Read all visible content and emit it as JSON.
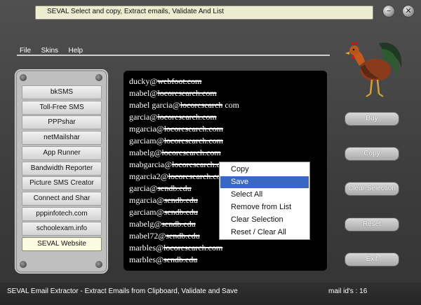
{
  "title": "SEVAL   Select and copy, Extract emails, Validate And List",
  "window_buttons": {
    "minimize": "−",
    "close": "✕"
  },
  "menu": [
    "File",
    "Skins",
    "Help"
  ],
  "sidebar": {
    "items": [
      {
        "label": "bkSMS"
      },
      {
        "label": "Toll-Free SMS"
      },
      {
        "label": "PPPshar"
      },
      {
        "label": "netMailshar"
      },
      {
        "label": "App Runner"
      },
      {
        "label": "Bandwidth Reporter"
      },
      {
        "label": "Picture SMS Creator"
      },
      {
        "label": "Connect and Shar"
      },
      {
        "label": "pppinfotech.com"
      },
      {
        "label": "schoolexam.info"
      },
      {
        "label": "SEVAL Website",
        "active": true
      }
    ]
  },
  "emails": [
    {
      "user": "ducky@",
      "domain": "webfoot.com"
    },
    {
      "user": "mabel@",
      "domain": "locoresearch.com"
    },
    {
      "user": "mabel garcia@",
      "domain": "locoresearch",
      "suffix": " com"
    },
    {
      "user": "garcia@",
      "domain": "locoresearch.com"
    },
    {
      "user": "mgarcia@",
      "domain": "locoresearch.com"
    },
    {
      "user": "garciam@",
      "domain": "locoresearch.com"
    },
    {
      "user": "mabelg@",
      "domain": "locoresearch.com"
    },
    {
      "user": "mabgarcia@",
      "domain": "locoresearch.com"
    },
    {
      "user": "mgarcia2@",
      "domain": "locoresearch.com"
    },
    {
      "user": "garcia@",
      "domain": "sendb.edu"
    },
    {
      "user": "mgarcia@",
      "domain": "sendb.edu"
    },
    {
      "user": "garciam@",
      "domain": "sendb.edu"
    },
    {
      "user": "mabelg@",
      "domain": "sendb.edu"
    },
    {
      "user": "mabel72@",
      "domain": "sendb.edu"
    },
    {
      "user": "marbles@",
      "domain": "locoresearch.com"
    },
    {
      "user": "marbles@",
      "domain": "sendb.edu"
    }
  ],
  "context_menu": {
    "items": [
      "Copy",
      "Save",
      "Select All",
      "Remove from List",
      "Clear Selection",
      "Reset / Clear All"
    ],
    "selected": "Save"
  },
  "actions": {
    "buy": "Buy",
    "copy": "Copy",
    "clear_selection": "Clear Selection",
    "reset": "Reset",
    "exit": "Exit"
  },
  "status": {
    "left": "SEVAL Email Extractor - Extract Emails from Clipboard, Validate and Save",
    "right": "mail id's : 16"
  },
  "colors": {
    "selection": "#3968c4",
    "list_background": "#000000",
    "active_sidebar": "#fbfbe2"
  }
}
